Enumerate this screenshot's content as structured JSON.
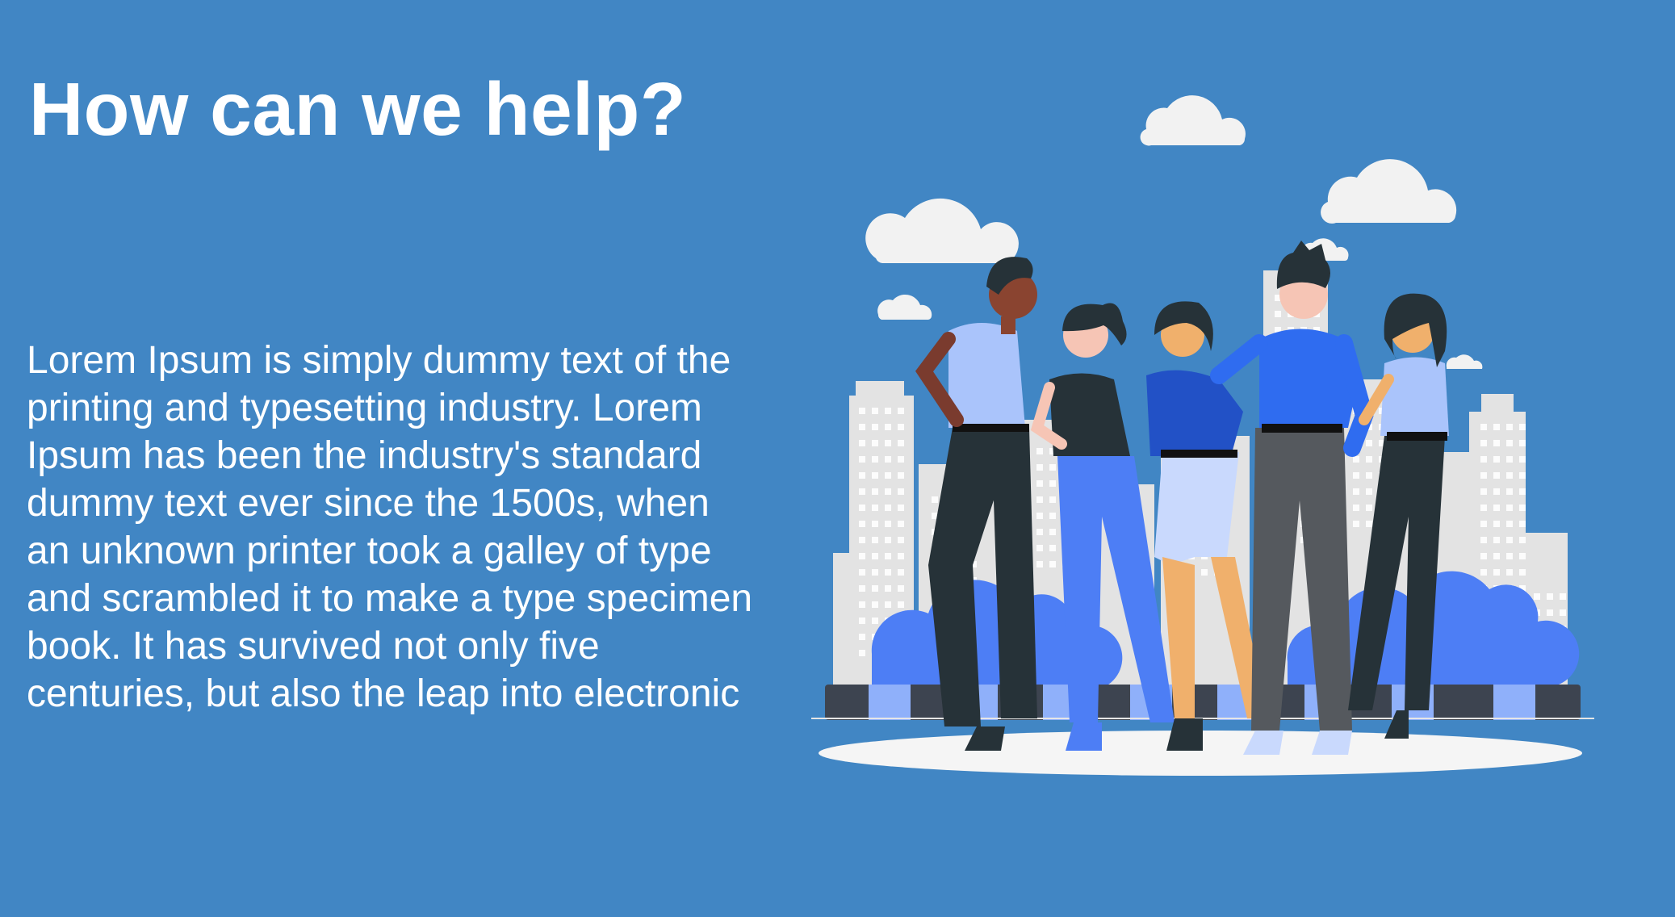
{
  "page": {
    "background_color": "#4186c4",
    "headline": "How can we help?",
    "body_lines": [
      "Lorem Ipsum is simply dummy text of the",
      "printing and typesetting industry. Lorem",
      "Ipsum has been the industry's standard",
      "dummy text ever since the 1500s, when",
      "an unknown printer took a galley of type",
      "and scrambled it to make a type specimen",
      "book. It has survived not only five",
      "centuries, but also the leap into electronic"
    ]
  },
  "illustration": {
    "subject": "group-of-five-people-in-city",
    "colors": {
      "cloud": "#f2f2f2",
      "building": "#e3e3e3",
      "window": "#ffffff",
      "bush": "#4d7ef5",
      "ground": "#f5f5f5",
      "dark": "#263238",
      "blue": "#2f6cf0",
      "light_blue": "#aac4fb"
    }
  }
}
